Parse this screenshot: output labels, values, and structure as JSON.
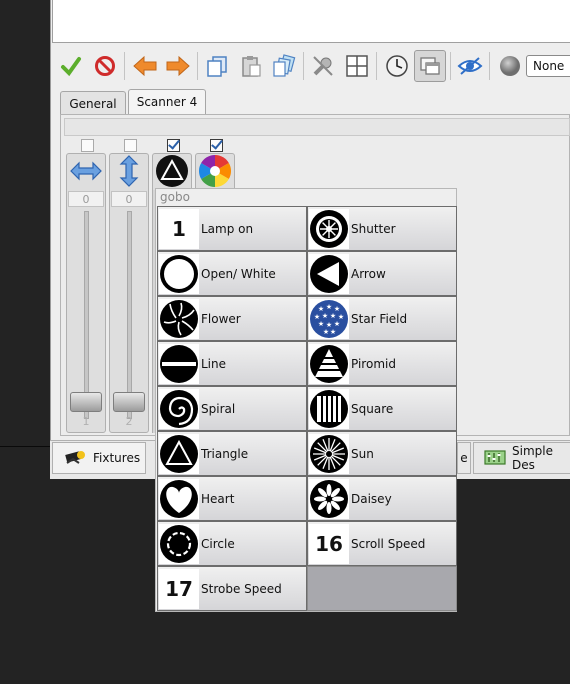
{
  "toolbar": {
    "combo_value": "None",
    "icons": [
      "apply-icon",
      "cancel-icon",
      "back-arrow-icon",
      "forward-arrow-icon",
      "copy-icon",
      "paste-icon",
      "clipboard-icon",
      "disable-icon",
      "grid-icon",
      "clock-icon",
      "window-icon",
      "visibility-icon",
      "circle-icon"
    ]
  },
  "tabs": [
    {
      "label": "General"
    },
    {
      "label": "Scanner 4"
    }
  ],
  "channels": [
    {
      "value": "0",
      "number": "1",
      "checked": false,
      "icon": "pan-icon"
    },
    {
      "value": "0",
      "number": "2",
      "checked": false,
      "icon": "tilt-icon"
    },
    {
      "checked": true,
      "icon": "gobo-icon"
    },
    {
      "checked": true,
      "icon": "color-wheel-icon"
    }
  ],
  "popup": {
    "title": "gobo",
    "items": [
      {
        "label": "Lamp on",
        "badge": "1"
      },
      {
        "label": "Shutter"
      },
      {
        "label": "Open/ White"
      },
      {
        "label": "Arrow"
      },
      {
        "label": "Flower"
      },
      {
        "label": "Star Field"
      },
      {
        "label": "Line"
      },
      {
        "label": "Piromid"
      },
      {
        "label": "Spiral"
      },
      {
        "label": "Square"
      },
      {
        "label": "Triangle"
      },
      {
        "label": "Sun"
      },
      {
        "label": "Heart"
      },
      {
        "label": "Daisey"
      },
      {
        "label": "Circle"
      },
      {
        "label": "Scroll Speed",
        "badge": "16"
      },
      {
        "label": "Strobe Speed",
        "badge": "17"
      }
    ]
  },
  "bottom_tabs": [
    {
      "label": "Fixtures"
    },
    {
      "label": "Simple Des"
    },
    {
      "label": "e"
    }
  ],
  "colors": {
    "accent": "#3b8ed9",
    "cell_border": "#6c6c6c"
  }
}
